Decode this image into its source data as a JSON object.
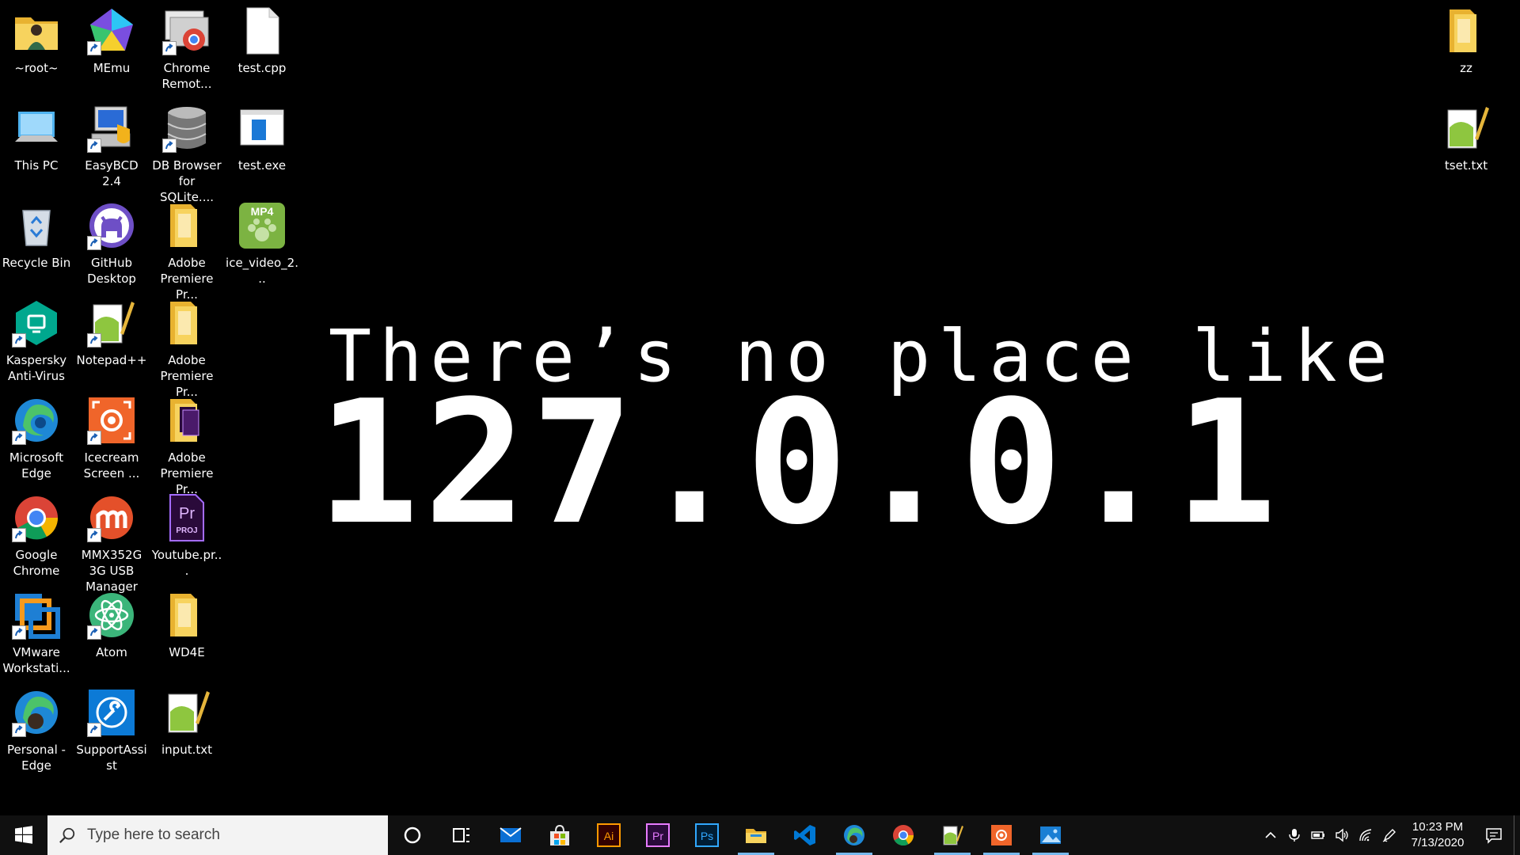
{
  "wallpaper": {
    "line1": "There’s no place like",
    "line2": "127.0.0.1"
  },
  "desktop_icons": {
    "root": "~root~",
    "memu": "MEmu",
    "chrome_remote": "Chrome Remot...",
    "test_cpp": "test.cpp",
    "this_pc": "This PC",
    "easybcd": "EasyBCD 2.4",
    "db_browser": "DB Browser for SQLite....",
    "test_exe": "test.exe",
    "recycle_bin": "Recycle Bin",
    "github_desktop": "GitHub Desktop",
    "adobe_premiere_1": "Adobe Premiere Pr...",
    "ice_video": "ice_video_2...",
    "ice_video_badge": "MP4",
    "kaspersky": "Kaspersky Anti-Virus",
    "notepadpp": "Notepad++",
    "adobe_premiere_2": "Adobe Premiere Pr...",
    "ms_edge": "Microsoft Edge",
    "icecream": "Icecream Screen ...",
    "adobe_premiere_3": "Adobe Premiere Pr...",
    "google_chrome": "Google Chrome",
    "mmx352g": "MMX352G 3G USB Manager",
    "youtube_proj": "Youtube.pr...",
    "youtube_proj_badge": "Pr",
    "youtube_proj_sub": "PROJ",
    "vmware": "VMware Workstati...",
    "atom": "Atom",
    "wd4e": "WD4E",
    "personal_edge": "Personal - Edge",
    "supportassist": "SupportAssist",
    "input_txt": "input.txt",
    "zz": "zz",
    "tset_txt": "tset.txt"
  },
  "taskbar": {
    "search_placeholder": "Type here to search",
    "apps": {
      "illustrator": "Ai",
      "premiere": "Pr",
      "photoshop": "Ps"
    },
    "clock_time": "10:23 PM",
    "clock_date": "7/13/2020"
  },
  "colors": {
    "taskbar_bg": "#101010",
    "active_indicator": "#76b9ed",
    "folder_yellow": "#f3c443",
    "edge_blue": "#1e88d6",
    "vscode_blue": "#0078d4"
  }
}
